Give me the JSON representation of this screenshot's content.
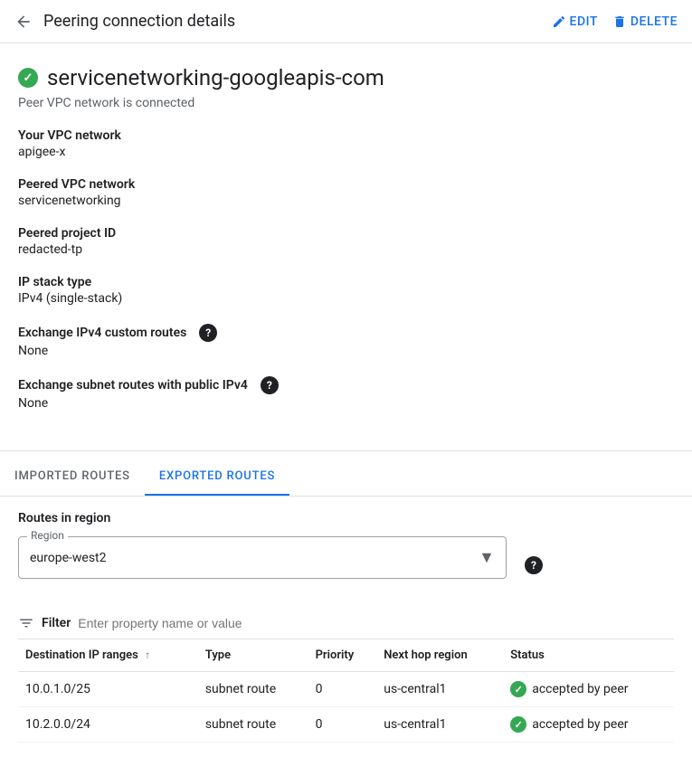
{
  "header": {
    "back_label": "←",
    "title": "Peering connection details",
    "edit_label": "EDIT",
    "delete_label": "DELETE",
    "edit_icon": "✏",
    "delete_icon": "🗑"
  },
  "service": {
    "name": "servicenetworking-googleapis-com",
    "status_text": "Peer VPC network is connected"
  },
  "fields": {
    "your_vpc_label": "Your VPC network",
    "your_vpc_value": "apigee-x",
    "peered_vpc_label": "Peered VPC network",
    "peered_vpc_value": "servicenetworking",
    "peered_project_label": "Peered project ID",
    "peered_project_value": "redacted-tp",
    "ip_stack_label": "IP stack type",
    "ip_stack_value": "IPv4 (single-stack)",
    "exchange_ipv4_label": "Exchange IPv4 custom routes",
    "exchange_ipv4_value": "None",
    "exchange_subnet_label": "Exchange subnet routes with public IPv4",
    "exchange_subnet_value": "None"
  },
  "tabs": [
    {
      "label": "IMPORTED ROUTES",
      "active": false
    },
    {
      "label": "EXPORTED ROUTES",
      "active": true
    }
  ],
  "routes": {
    "section_title": "Routes in region",
    "region_label": "Region",
    "region_value": "europe-west2",
    "filter_label": "Filter",
    "filter_placeholder": "Enter property name or value",
    "table": {
      "columns": [
        {
          "label": "Destination IP ranges",
          "sortable": true
        },
        {
          "label": "Type",
          "sortable": false
        },
        {
          "label": "Priority",
          "sortable": false
        },
        {
          "label": "Next hop region",
          "sortable": false
        },
        {
          "label": "Status",
          "sortable": false
        }
      ],
      "rows": [
        {
          "destination": "10.0.1.0/25",
          "type": "subnet route",
          "priority": "0",
          "next_hop_region": "us-central1",
          "status": "accepted by peer"
        },
        {
          "destination": "10.2.0.0/24",
          "type": "subnet route",
          "priority": "0",
          "next_hop_region": "us-central1",
          "status": "accepted by peer"
        }
      ]
    }
  }
}
